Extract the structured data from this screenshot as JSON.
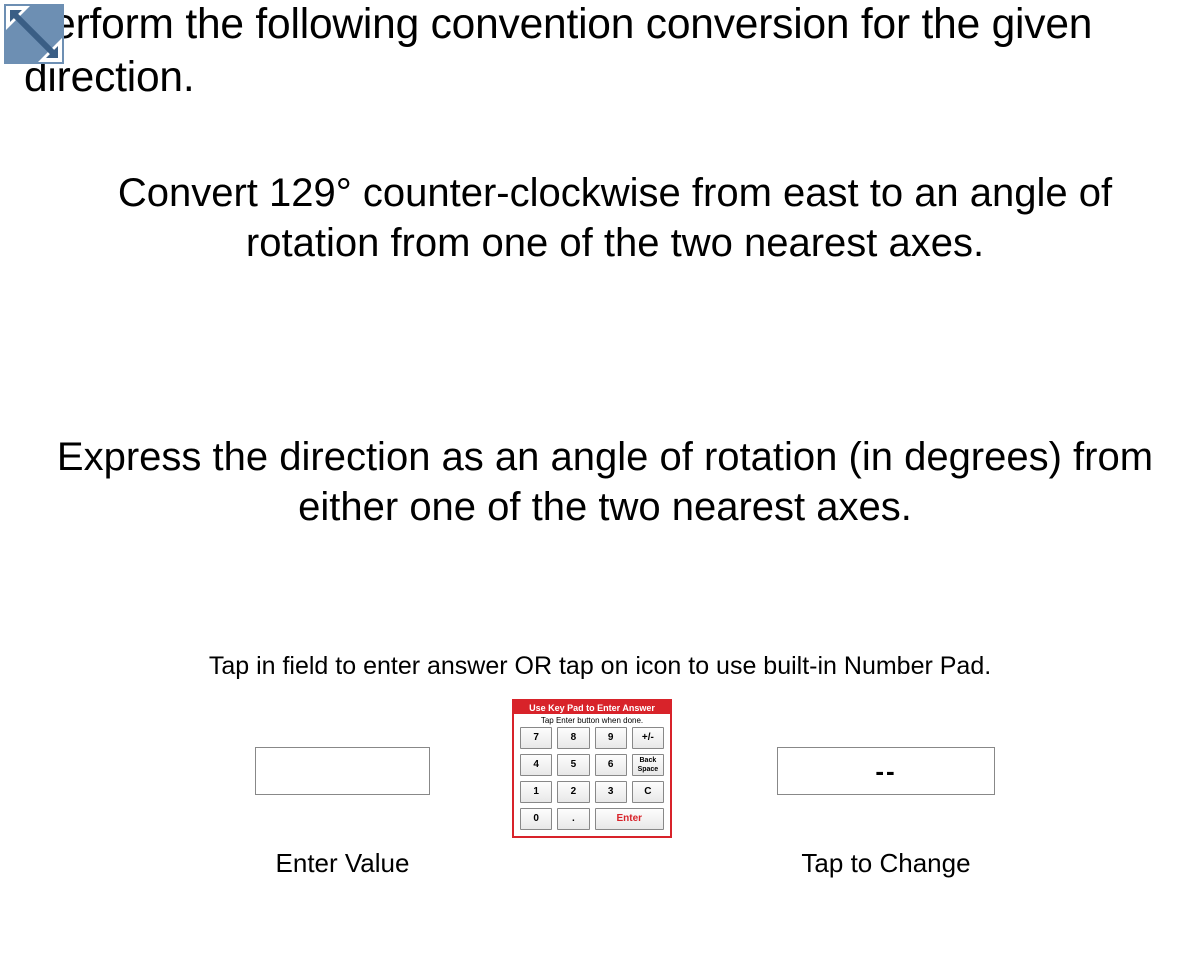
{
  "title": "Perform the following convention conversion for the given direction.",
  "subtitle": "Convert 129° counter-clockwise from east to an angle of rotation from one of the two nearest axes.",
  "instruction2": "Express the direction as an angle of rotation (in degrees) from either one of the two nearest axes.",
  "helper": "Tap in field to enter answer OR tap on icon to use built-in Number Pad.",
  "answer": {
    "value": "",
    "label": "Enter Value"
  },
  "unit": {
    "value": "--",
    "label": "Tap to Change"
  },
  "keypad": {
    "title": "Use Key Pad to Enter Answer",
    "sub": "Tap Enter button when done.",
    "keys": {
      "k7": "7",
      "k8": "8",
      "k9": "9",
      "pm": "+/-",
      "k4": "4",
      "k5": "5",
      "k6": "6",
      "bs": "Back Space",
      "k1": "1",
      "k2": "2",
      "k3": "3",
      "c": "C",
      "k0": "0",
      "dot": ".",
      "enter": "Enter"
    }
  }
}
